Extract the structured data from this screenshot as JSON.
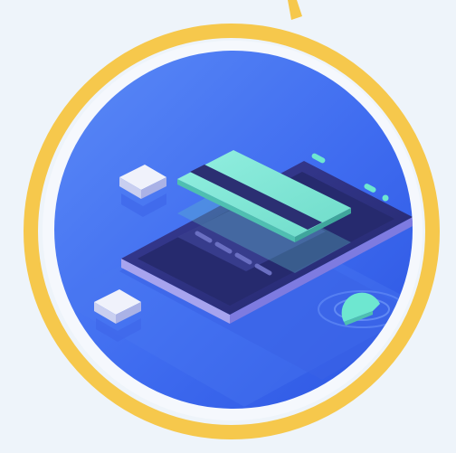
{
  "illustration": {
    "subject": "mobile-card-payment",
    "icons": [
      "ring-icon",
      "smartphone-icon",
      "credit-card-icon",
      "chip-icon",
      "contactless-signal-icon"
    ]
  },
  "colors": {
    "page_background": "#eef4fa",
    "ring": "#f6c84c",
    "disc_light": "#4f7df3",
    "disc_dark": "#2b54e0",
    "phone_body": "#2c2f82",
    "phone_screen": "#262a6e",
    "card": "#7de6d6",
    "card_stripe": "#2b2f72",
    "accent_mint": "#6ee7d0",
    "block_light": "#e4e8f7"
  }
}
